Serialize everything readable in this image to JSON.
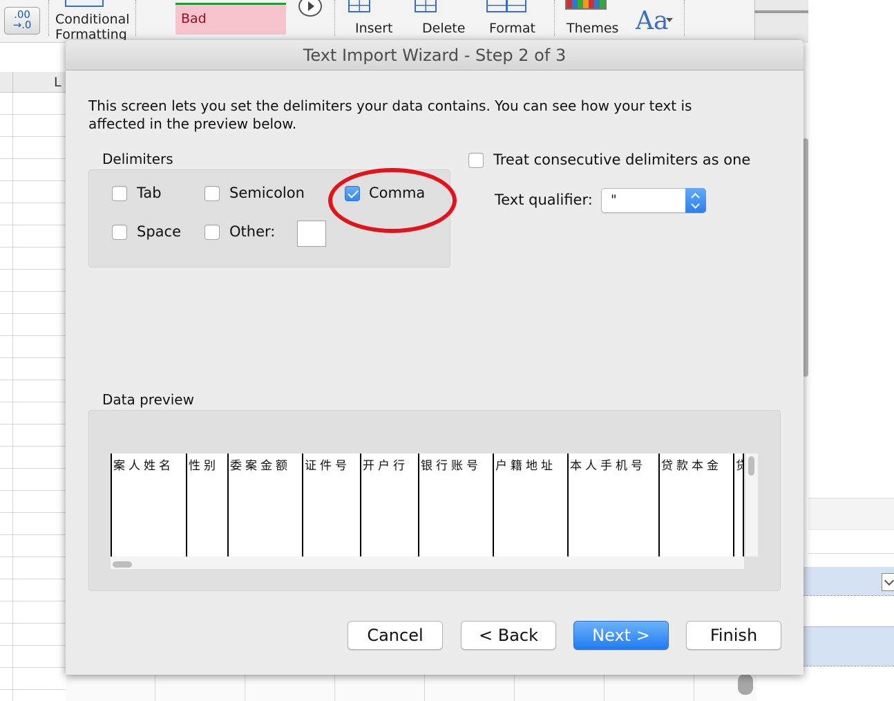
{
  "ribbon": {
    "decimal_label": ".00\n→.0",
    "conditional_formatting_label": "Conditional\nFormatting",
    "bad_style_label": "Bad",
    "insert_label": "Insert",
    "delete_label": "Delete",
    "format_label": "Format",
    "themes_label": "Themes",
    "font_size_label": "Aa"
  },
  "sheet": {
    "column_header": "L"
  },
  "dialog": {
    "title": "Text Import Wizard - Step 2 of 3",
    "intro": "This screen lets you set the delimiters your data contains.  You can see how your text is\naffected in the preview below.",
    "delimiters_label": "Delimiters",
    "delimiters": {
      "tab": {
        "label": "Tab",
        "checked": false
      },
      "semicolon": {
        "label": "Semicolon",
        "checked": false
      },
      "comma": {
        "label": "Comma",
        "checked": true
      },
      "space": {
        "label": "Space",
        "checked": false
      },
      "other": {
        "label": "Other:",
        "checked": false,
        "value": ""
      }
    },
    "consecutive": {
      "label": "Treat consecutive delimiters as one",
      "checked": false
    },
    "text_qualifier": {
      "label": "Text qualifier:",
      "value": "\""
    },
    "preview_label": "Data preview",
    "preview_columns": [
      "案人姓名",
      "性别",
      "委案金额",
      "证件号",
      "开户行",
      "银行账号",
      "户籍地址",
      "本人手机号",
      "贷款本金",
      "贷"
    ],
    "buttons": {
      "cancel": "Cancel",
      "back": "< Back",
      "next": "Next >",
      "finish": "Finish"
    }
  },
  "colors": {
    "accent": "#2f86f1",
    "annotation_circle": "#e3131b",
    "bad_fill": "#f7c3cc"
  }
}
